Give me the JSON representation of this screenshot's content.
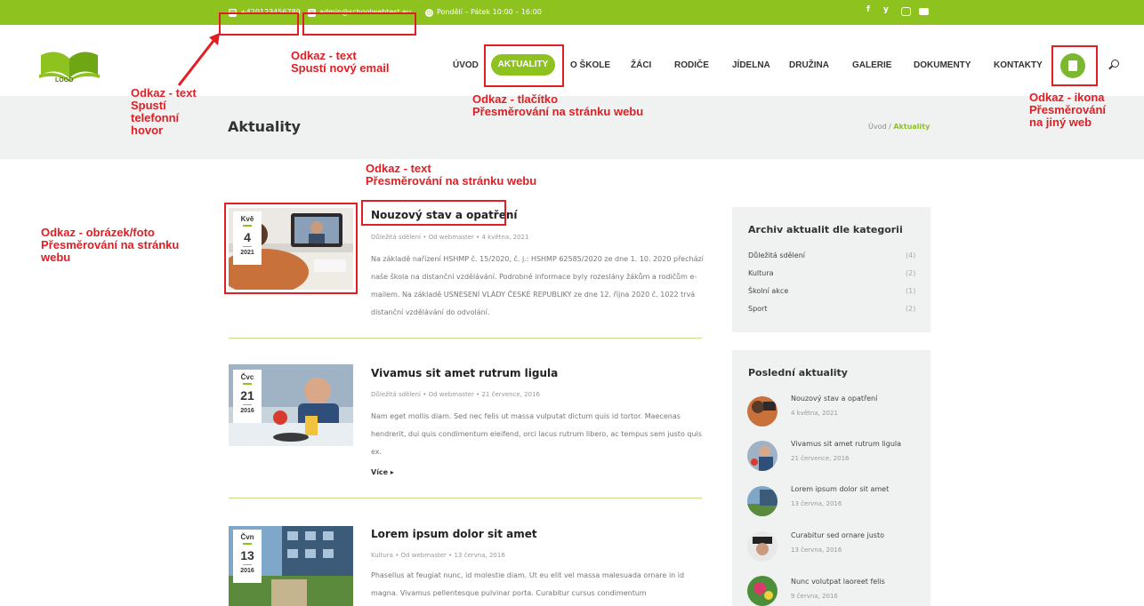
{
  "topbar": {
    "phone": "+420123456789",
    "email": "admin@schoolwebtest.eu",
    "hours": "Pondělí – Pátek 10:00 – 16:00",
    "social": [
      "facebook-icon",
      "twitter-icon",
      "instagram-icon",
      "youtube-icon"
    ],
    "social_glyphs": {
      "facebook": "f",
      "twitter": "y"
    }
  },
  "header": {
    "logo_text": "LOGO",
    "nav": [
      "ÚVOD",
      "AKTUALITY",
      "O ŠKOLE",
      "ŽÁCI",
      "RODIČE",
      "JÍDELNA",
      "DRUŽINA",
      "GALERIE",
      "DOKUMENTY",
      "KONTAKTY"
    ],
    "active": "AKTUALITY"
  },
  "page": {
    "title": "Aktuality",
    "breadcrumb_home": "Úvod",
    "breadcrumb_sep": "/",
    "breadcrumb_current": "Aktuality"
  },
  "posts": [
    {
      "month": "Kvě",
      "day": "4",
      "year": "2021",
      "title": "Nouzový stav a opatření",
      "meta": "Důležitá sdělení • Od webmaster • 4 května, 2021",
      "body": "Na základě nařízení HSHMP č. 15/2020, č. j.: HSHMP 62585/2020 ze dne 1. 10. 2020 přechází naše škola na distanční vzdělávání. Podrobné informace byly rozeslány žákům a rodičům e-mailem. Na základě USNESENÍ VLÁDY ČESKÉ REPUBLIKY ze dne 12. října 2020 č. 1022 trvá distanční vzdělávání do odvolání.",
      "more": ""
    },
    {
      "month": "Čvc",
      "day": "21",
      "year": "2016",
      "title": "Vivamus sit amet rutrum ligula",
      "meta": "Důležitá sdělení • Od webmaster • 21 července, 2016",
      "body": "Nam eget mollis diam. Sed nec felis ut massa vulputat dictum quis id tortor. Maecenas hendrerit, dui quis condimentum eleifend, orci lacus rutrum libero, ac tempus sem justo quis ex.",
      "more": "Více"
    },
    {
      "month": "Čvn",
      "day": "13",
      "year": "2016",
      "title": "Lorem ipsum dolor sit amet",
      "meta": "Kultura • Od webmaster • 13 června, 2016",
      "body": "Phasellus at feugiat nunc, id molestie diam. Ut eu elit vel massa malesuada ornare in id magna. Vivamus pellentesque pulvinar porta. Curabitur cursus condimentum",
      "more": ""
    }
  ],
  "sidebar": {
    "archive_title": "Archiv aktualit dle kategorii",
    "categories": [
      {
        "name": "Důležitá sdělení",
        "count": "(4)"
      },
      {
        "name": "Kultura",
        "count": "(2)"
      },
      {
        "name": "Školní akce",
        "count": "(1)"
      },
      {
        "name": "Sport",
        "count": "(2)"
      }
    ],
    "recent_title": "Poslední aktuality",
    "recent": [
      {
        "title": "Nouzový stav a opatření",
        "date": "4 května, 2021"
      },
      {
        "title": "Vivamus sit amet rutrum ligula",
        "date": "21 července, 2016"
      },
      {
        "title": "Lorem ipsum dolor sit amet",
        "date": "13 června, 2016"
      },
      {
        "title": "Curabitur sed ornare justo",
        "date": "13 června, 2016"
      },
      {
        "title": "Nunc volutpat laoreet felis",
        "date": "9 června, 2016"
      }
    ]
  },
  "annotations": {
    "phone": [
      "Odkaz - text",
      "Spustí",
      "telefonní",
      "hovor"
    ],
    "email": [
      "Odkaz - text",
      "Spustí nový email"
    ],
    "button": [
      "Odkaz - tlačítko",
      "Přesměrování na stránku webu"
    ],
    "icon": [
      "Odkaz - ikona",
      "Přesměrování",
      "na jiný web"
    ],
    "title": [
      "Odkaz - text",
      "Přesměrování na stránku webu"
    ],
    "image": [
      "Odkaz - obrázek/foto",
      "Přesměrování na stránku",
      "webu"
    ]
  },
  "colors": {
    "accent": "#8dc21f",
    "annotation": "#e01e24",
    "title_bar": "#f0f1f1"
  }
}
